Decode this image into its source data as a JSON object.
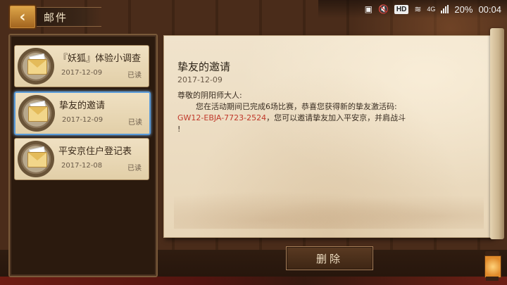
{
  "status_bar": {
    "hd": "HD",
    "network": "4G",
    "battery": "20%",
    "time": "00:04"
  },
  "header": {
    "back_icon": "chevron-left-icon",
    "title": "邮件"
  },
  "mail_list": [
    {
      "title": "『妖狐』体验小调查",
      "date": "2017-12-09",
      "status": "已读",
      "icon": "envelope-icon",
      "selected": false
    },
    {
      "title": "挚友的邀请",
      "date": "2017-12-09",
      "status": "已读",
      "icon": "envelope-icon",
      "selected": true
    },
    {
      "title": "平安京住户登记表",
      "date": "2017-12-08",
      "status": "已读",
      "icon": "envelope-icon",
      "selected": false
    }
  ],
  "letter": {
    "title": "挚友的邀请",
    "date": "2017-12-09",
    "greeting": "尊敬的阴阳师大人:",
    "line1": "您在活动期间已完成6场比赛，恭喜您获得新的挚友激活码:",
    "code": "GW12-EBJA-7723-2524",
    "line2": "，您可以邀请挚友加入平安京，并肩战斗",
    "line3": "!"
  },
  "actions": {
    "delete_label": "删除"
  },
  "colors": {
    "code_red": "#c0392b",
    "selection_blue": "#5a9ad8"
  }
}
